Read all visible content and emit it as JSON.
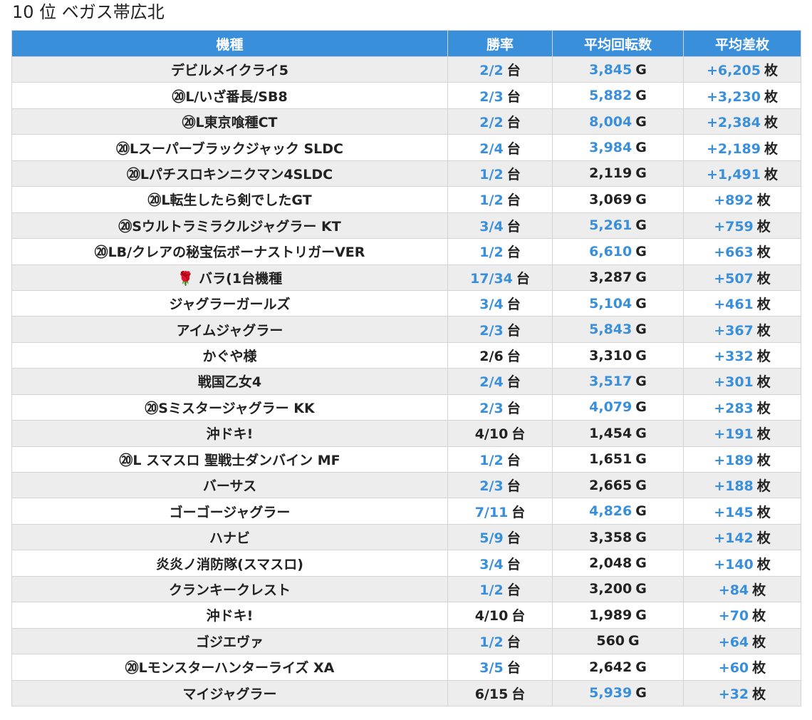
{
  "title": "10 位 ベガス帯広北",
  "headers": [
    "機種",
    "勝率",
    "平均回転数",
    "平均差枚"
  ],
  "units": {
    "machines": "台",
    "spins": "G",
    "diff": "枚"
  },
  "colors": {
    "header_bg": "#3a8fdb",
    "link": "#3a8fdb",
    "row_alt": "#ededed"
  },
  "rows": [
    {
      "name": "デビルメイクライ5",
      "win": "2/2",
      "win_link": true,
      "spins": "3,845",
      "spins_link": true,
      "diff": "+6,205"
    },
    {
      "name": "⑳L/いざ番長/SB8",
      "win": "2/3",
      "win_link": true,
      "spins": "5,882",
      "spins_link": true,
      "diff": "+3,230"
    },
    {
      "name": "⑳L東京喰種CT",
      "win": "2/2",
      "win_link": true,
      "spins": "8,004",
      "spins_link": true,
      "diff": "+2,384"
    },
    {
      "name": "⑳Lスーパーブラックジャック SLDC",
      "win": "2/4",
      "win_link": true,
      "spins": "3,984",
      "spins_link": true,
      "diff": "+2,189"
    },
    {
      "name": "⑳Lパチスロキンニクマン4SLDC",
      "win": "1/2",
      "win_link": true,
      "spins": "2,119",
      "spins_link": false,
      "diff": "+1,491"
    },
    {
      "name": "⑳L転生したら剣でしたGT",
      "win": "1/2",
      "win_link": true,
      "spins": "3,069",
      "spins_link": false,
      "diff": "+892"
    },
    {
      "name": "⑳Sウルトラミラクルジャグラー KT",
      "win": "3/4",
      "win_link": true,
      "spins": "5,261",
      "spins_link": true,
      "diff": "+759"
    },
    {
      "name": "⑳LB/クレアの秘宝伝ボーナストリガーVER",
      "win": "1/2",
      "win_link": true,
      "spins": "6,610",
      "spins_link": true,
      "diff": "+663"
    },
    {
      "name": "🌹 バラ(1台機種",
      "win": "17/34",
      "win_link": true,
      "spins": "3,287",
      "spins_link": false,
      "diff": "+507"
    },
    {
      "name": "ジャグラーガールズ",
      "win": "3/4",
      "win_link": true,
      "spins": "5,104",
      "spins_link": true,
      "diff": "+461"
    },
    {
      "name": "アイムジャグラー",
      "win": "2/3",
      "win_link": true,
      "spins": "5,843",
      "spins_link": true,
      "diff": "+367"
    },
    {
      "name": "かぐや様",
      "win": "2/6",
      "win_link": false,
      "spins": "3,310",
      "spins_link": false,
      "diff": "+332"
    },
    {
      "name": "戦国乙女4",
      "win": "2/4",
      "win_link": true,
      "spins": "3,517",
      "spins_link": true,
      "diff": "+301"
    },
    {
      "name": "⑳Sミスタージャグラー KK",
      "win": "2/3",
      "win_link": true,
      "spins": "4,079",
      "spins_link": true,
      "diff": "+283"
    },
    {
      "name": "沖ドキ!",
      "win": "4/10",
      "win_link": false,
      "spins": "1,454",
      "spins_link": false,
      "diff": "+191"
    },
    {
      "name": "⑳L スマスロ 聖戦士ダンバイン MF",
      "win": "1/2",
      "win_link": true,
      "spins": "1,651",
      "spins_link": false,
      "diff": "+189"
    },
    {
      "name": "バーサス",
      "win": "2/3",
      "win_link": true,
      "spins": "2,665",
      "spins_link": false,
      "diff": "+188"
    },
    {
      "name": "ゴーゴージャグラー",
      "win": "7/11",
      "win_link": true,
      "spins": "4,826",
      "spins_link": true,
      "diff": "+145"
    },
    {
      "name": "ハナビ",
      "win": "5/9",
      "win_link": true,
      "spins": "3,358",
      "spins_link": false,
      "diff": "+142"
    },
    {
      "name": "炎炎ノ消防隊(スマスロ)",
      "win": "3/4",
      "win_link": true,
      "spins": "2,048",
      "spins_link": false,
      "diff": "+140"
    },
    {
      "name": "クランキークレスト",
      "win": "1/2",
      "win_link": true,
      "spins": "3,200",
      "spins_link": false,
      "diff": "+84"
    },
    {
      "name": "沖ドキ!",
      "win": "4/10",
      "win_link": false,
      "spins": "1,989",
      "spins_link": false,
      "diff": "+70"
    },
    {
      "name": "ゴジエヴァ",
      "win": "1/2",
      "win_link": true,
      "spins": "560",
      "spins_link": false,
      "diff": "+64"
    },
    {
      "name": "⑳Lモンスターハンターライズ XA",
      "win": "3/5",
      "win_link": true,
      "spins": "2,642",
      "spins_link": false,
      "diff": "+60"
    },
    {
      "name": "マイジャグラー",
      "win": "6/15",
      "win_link": false,
      "spins": "5,939",
      "spins_link": true,
      "diff": "+32"
    }
  ]
}
